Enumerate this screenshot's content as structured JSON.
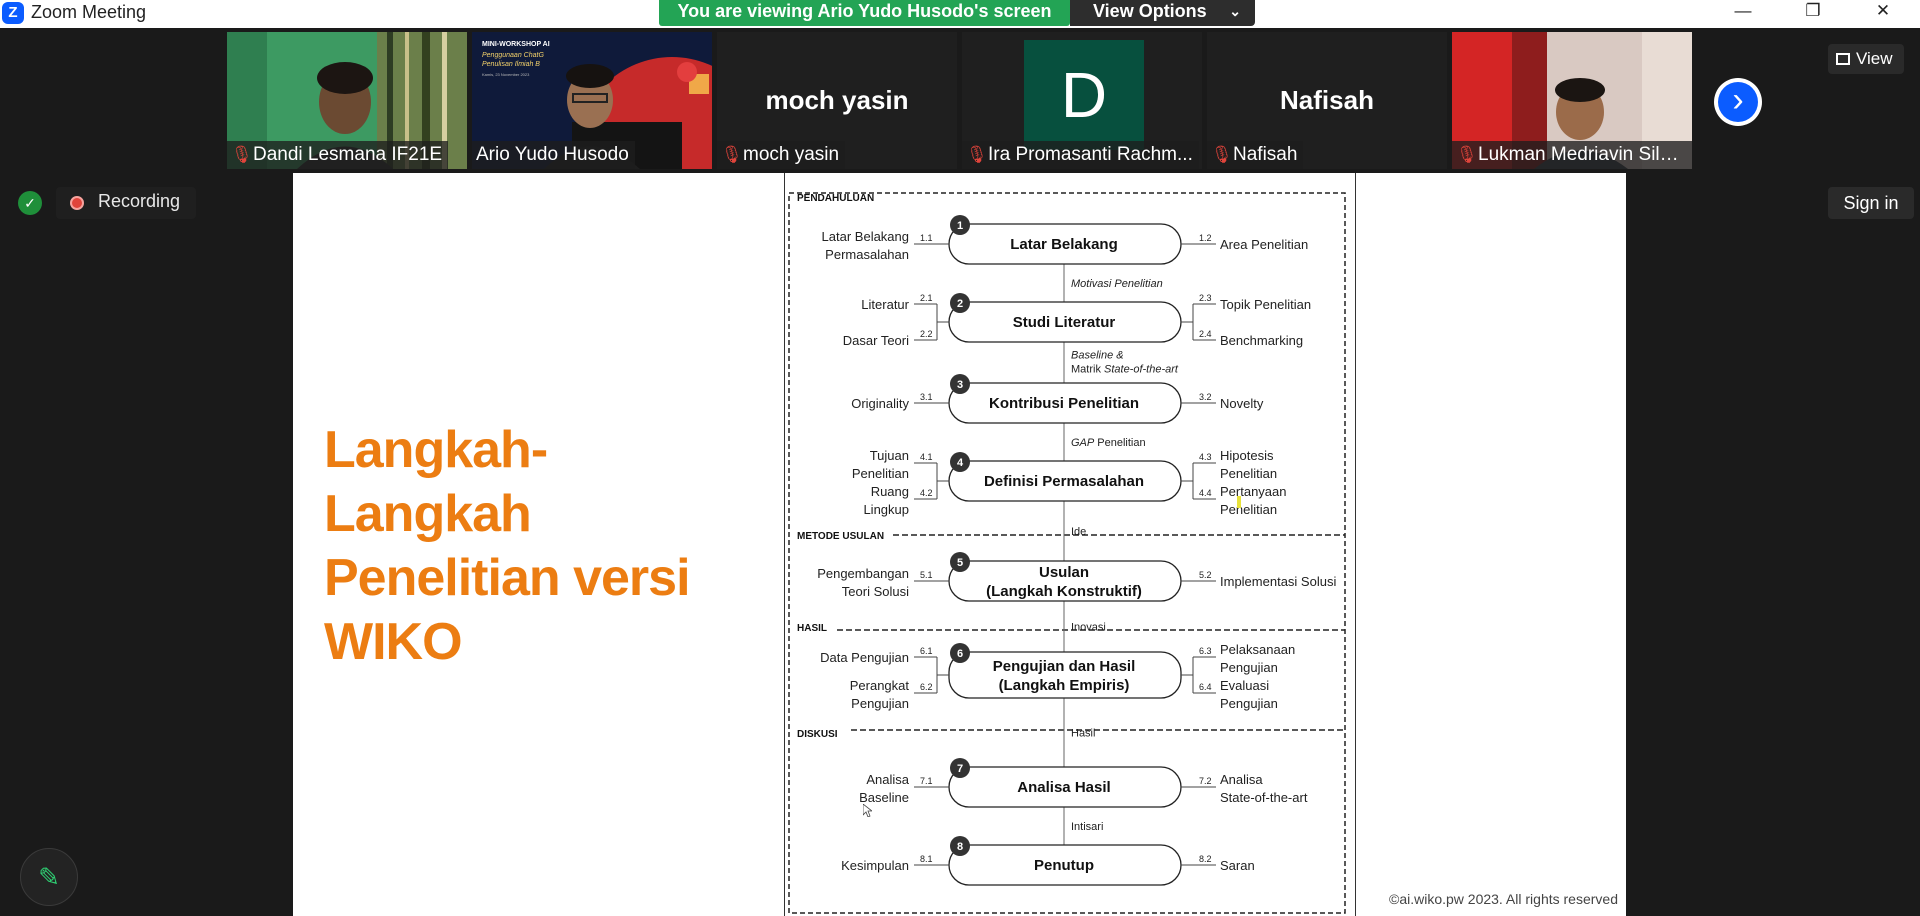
{
  "window": {
    "title": "Zoom Meeting",
    "logo_letter": "Z",
    "minimize_glyph": "—",
    "restore_glyph": "❐",
    "close_glyph": "✕"
  },
  "banner": {
    "text": "You are viewing Ario Yudo Husodo's screen",
    "view_options_label": "View Options",
    "view_options_chevron": "⌄"
  },
  "gallery": {
    "participants": [
      {
        "name": "Dandi Lesmana IF21E",
        "muted": true,
        "kind": "video"
      },
      {
        "name": "Ario Yudo Husodo",
        "muted": false,
        "kind": "video",
        "active": true
      },
      {
        "name": "moch yasin",
        "muted": true,
        "kind": "name",
        "display_name": "moch yasin"
      },
      {
        "name": "Ira Promasanti Rachm...",
        "muted": true,
        "kind": "avatar",
        "avatar_letter": "D",
        "avatar_color": "#07503e"
      },
      {
        "name": "Nafisah",
        "muted": true,
        "kind": "name",
        "display_name": "Nafisah"
      },
      {
        "name": "Lukman Medriavin Sila...",
        "muted": true,
        "kind": "video"
      }
    ],
    "next_page_icon": "chevron-right-icon",
    "view_label": "View"
  },
  "status": {
    "recording_label": "Recording",
    "sign_in_label": "Sign in"
  },
  "slide": {
    "title_lines": [
      "Langkah-Langkah",
      "Penelitian versi",
      "WIKO"
    ],
    "copyright": "©ai.wiko.pw 2023. All rights reserved",
    "poster": {
      "line1": "MINI-WORKSHOP AI",
      "line2": "Penggunaan ChatG",
      "line3": "Penulisan Ilmiah B",
      "line4": "Kamis, 23 November 2023"
    },
    "diagram": {
      "sections": [
        "PENDAHULUAN",
        "METODE USULAN",
        "HASIL",
        "DISKUSI"
      ],
      "steps": [
        {
          "n": "1",
          "title": [
            "Latar Belakang"
          ],
          "left": [
            {
              "code": "1.1",
              "label": [
                "Latar Belakang",
                "Permasalahan"
              ]
            }
          ],
          "right": [
            {
              "code": "1.2",
              "label": [
                "Area Penelitian"
              ]
            }
          ]
        },
        {
          "n": "2",
          "title": [
            "Studi Literatur"
          ],
          "left": [
            {
              "code": "2.1",
              "label": [
                "Literatur"
              ]
            },
            {
              "code": "2.2",
              "label": [
                "Dasar Teori"
              ]
            }
          ],
          "right": [
            {
              "code": "2.3",
              "label": [
                "Topik Penelitian"
              ]
            },
            {
              "code": "2.4",
              "label": [
                "Benchmarking"
              ]
            }
          ]
        },
        {
          "n": "3",
          "title": [
            "Kontribusi Penelitian"
          ],
          "left": [
            {
              "code": "3.1",
              "label": [
                "Originality"
              ]
            }
          ],
          "right": [
            {
              "code": "3.2",
              "label": [
                "Novelty"
              ]
            }
          ]
        },
        {
          "n": "4",
          "title": [
            "Definisi Permasalahan"
          ],
          "left": [
            {
              "code": "4.1",
              "label": [
                "Tujuan",
                "Penelitian"
              ]
            },
            {
              "code": "4.2",
              "label": [
                "Ruang",
                "Lingkup"
              ]
            }
          ],
          "right": [
            {
              "code": "4.3",
              "label": [
                "Hipotesis",
                "Penelitian"
              ]
            },
            {
              "code": "4.4",
              "label": [
                "Pertanyaan",
                "Penelitian"
              ]
            }
          ]
        },
        {
          "n": "5",
          "title": [
            "Usulan",
            "(Langkah Konstruktif)"
          ],
          "left": [
            {
              "code": "5.1",
              "label": [
                "Pengembangan",
                "Teori Solusi"
              ]
            }
          ],
          "right": [
            {
              "code": "5.2",
              "label": [
                "Implementasi Solusi"
              ]
            }
          ]
        },
        {
          "n": "6",
          "title": [
            "Pengujian dan Hasil",
            "(Langkah Empiris)"
          ],
          "left": [
            {
              "code": "6.1",
              "label": [
                "Data Pengujian"
              ]
            },
            {
              "code": "6.2",
              "label": [
                "Perangkat",
                "Pengujian"
              ]
            }
          ],
          "right": [
            {
              "code": "6.3",
              "label": [
                "Pelaksanaan",
                "Pengujian"
              ]
            },
            {
              "code": "6.4",
              "label": [
                "Evaluasi",
                "Pengujian"
              ]
            }
          ]
        },
        {
          "n": "7",
          "title": [
            "Analisa Hasil"
          ],
          "left": [
            {
              "code": "7.1",
              "label": [
                "Analisa",
                "Baseline"
              ]
            }
          ],
          "right": [
            {
              "code": "7.2",
              "label": [
                "Analisa",
                "State-of-the-art"
              ]
            }
          ]
        },
        {
          "n": "8",
          "title": [
            "Penutup"
          ],
          "left": [
            {
              "code": "8.1",
              "label": [
                "Kesimpulan"
              ]
            }
          ],
          "right": [
            {
              "code": "8.2",
              "label": [
                "Saran"
              ]
            }
          ]
        }
      ],
      "connectors": [
        {
          "parts": [
            {
              "t": "Motivasi Penelitian",
              "i": true
            }
          ]
        },
        {
          "parts": [
            {
              "t": "Baseline &",
              "i": true
            }
          ],
          "parts2": [
            {
              "t": "Matrik ",
              "i": false
            },
            {
              "t": "State-of-the-art",
              "i": true
            }
          ]
        },
        {
          "parts": [
            {
              "t": "GAP",
              "i": true
            },
            {
              "t": " Penelitian",
              "i": false
            }
          ]
        },
        {
          "parts": [
            {
              "t": "Ide",
              "i": false
            }
          ]
        },
        {
          "parts": [
            {
              "t": "Inovasi",
              "i": false
            }
          ]
        },
        {
          "parts": [
            {
              "t": "Hasil",
              "i": false
            }
          ]
        },
        {
          "parts": [
            {
              "t": "Intisari",
              "i": false
            }
          ]
        }
      ]
    }
  }
}
